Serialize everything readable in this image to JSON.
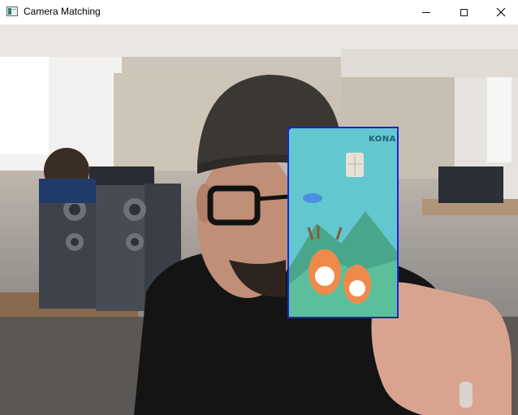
{
  "window": {
    "title": "Camera Matching",
    "icon": "app-window-icon",
    "controls": {
      "minimize_icon": "minimize-icon",
      "maximize_icon": "maximize-icon",
      "close_icon": "close-icon"
    }
  },
  "feed": {
    "detection_box_color": "#1f1fe0",
    "card": {
      "brand": "KONA",
      "chip_icon": "card-chip-icon",
      "wifi_icon": "contactless-icon"
    }
  },
  "colors": {
    "titlebar_bg": "#ffffff",
    "card_teal": "#63c7cf",
    "card_mountain": "#4aa68a"
  }
}
